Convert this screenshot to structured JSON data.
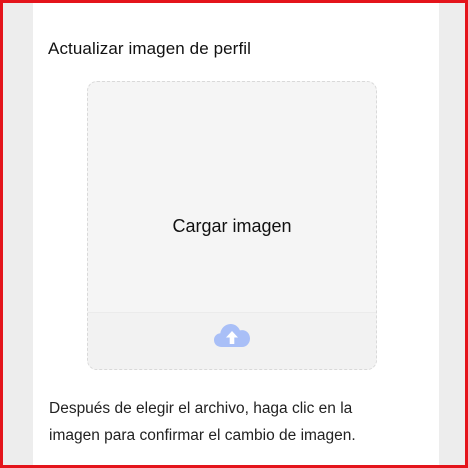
{
  "panel": {
    "title": "Actualizar imagen de perfil"
  },
  "upload": {
    "label": "Cargar imagen",
    "icon": "cloud-upload-icon",
    "icon_color": "#a9bff7"
  },
  "hint": {
    "line1": "Después de elegir el archivo, haga clic en la",
    "line2": "imagen para confirmar el cambio de imagen."
  },
  "colors": {
    "frame_border": "#e4141b",
    "side_background": "#ededed"
  }
}
